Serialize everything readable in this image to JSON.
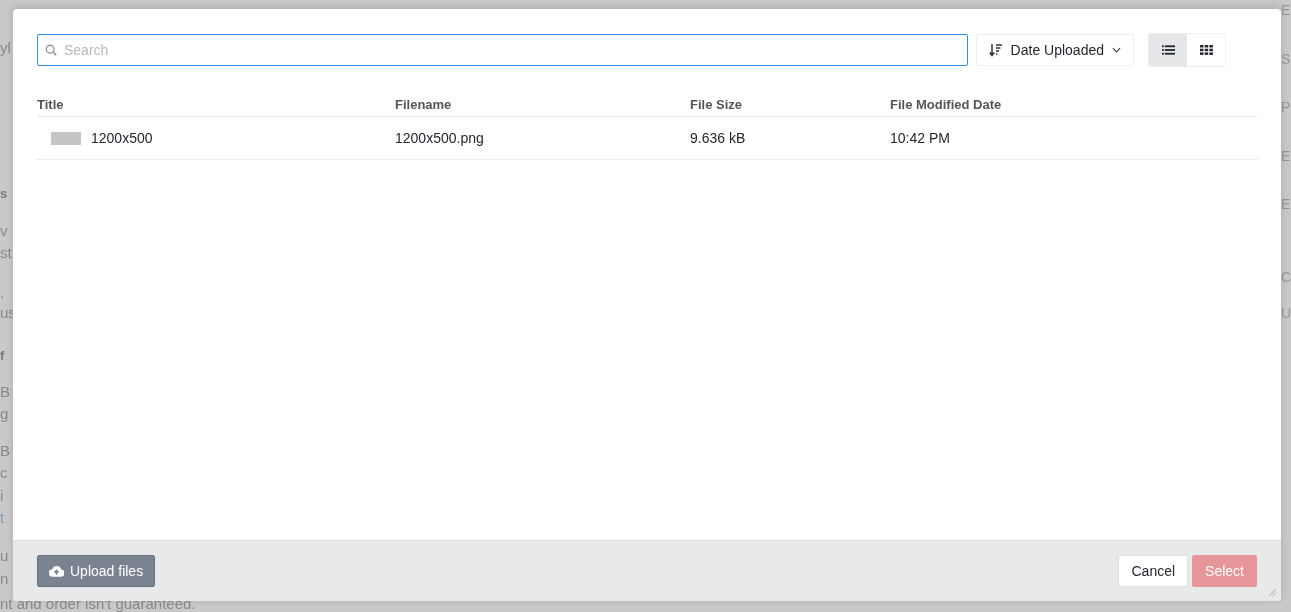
{
  "background": {
    "left_fragments": [
      {
        "text": "yl",
        "kind": "text"
      },
      {
        "text": "s",
        "kind": "bold"
      },
      {
        "text": "v",
        "kind": "text"
      },
      {
        "text": "st",
        "kind": "text"
      },
      {
        "text": ",",
        "kind": "text"
      },
      {
        "text": "us",
        "kind": "text"
      },
      {
        "text": "f",
        "kind": "bold"
      },
      {
        "text": "B",
        "kind": "text"
      },
      {
        "text": "g",
        "kind": "text"
      },
      {
        "text": "B",
        "kind": "text"
      },
      {
        "text": "c",
        "kind": "text"
      },
      {
        "text": "i",
        "kind": "text"
      },
      {
        "text": "t",
        "kind": "link"
      },
      {
        "text": "u",
        "kind": "text"
      },
      {
        "text": "n",
        "kind": "text"
      },
      {
        "text": "nt and order isn't guaranteed.",
        "kind": "text"
      }
    ],
    "right_fragments": [
      "E",
      "S",
      "P",
      "E",
      "E",
      "C",
      "U"
    ]
  },
  "search": {
    "placeholder": "Search"
  },
  "sort": {
    "label": "Date Uploaded"
  },
  "views": [
    {
      "kind": "list",
      "selected": true
    },
    {
      "kind": "grid",
      "selected": false
    }
  ],
  "table": {
    "columns": [
      "Title",
      "Filename",
      "File Size",
      "File Modified Date"
    ],
    "rows": [
      {
        "title": "1200x500",
        "filename": "1200x500.png",
        "size": "9.636 kB",
        "modified": "10:42 PM"
      }
    ]
  },
  "footer": {
    "upload": "Upload files",
    "cancel": "Cancel",
    "select": "Select",
    "select_disabled": true
  }
}
